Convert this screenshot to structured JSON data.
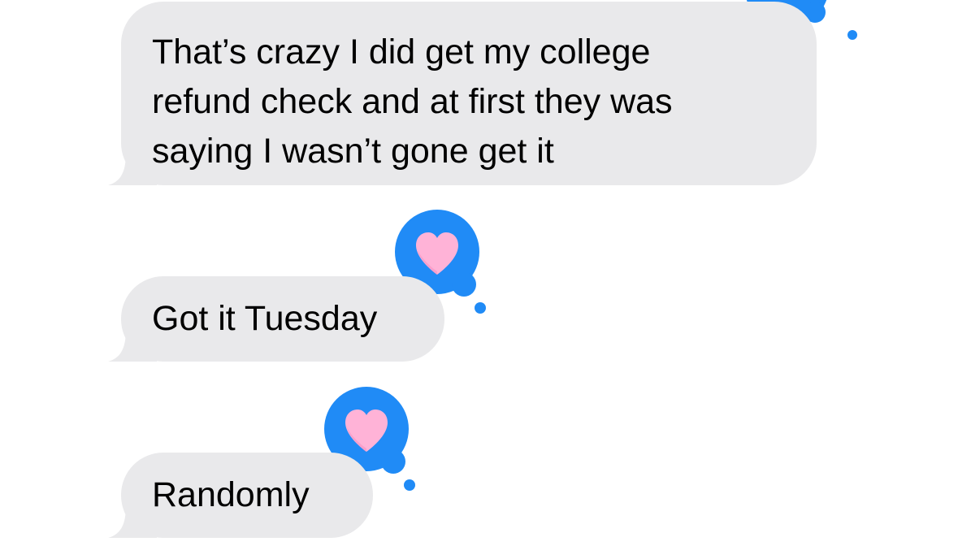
{
  "messages": [
    {
      "text": "That’s crazy I did get my college\nrefund check and at first they was\nsaying I wasn’t gone get it",
      "reaction": "heart-icon"
    },
    {
      "text": "Got it Tuesday",
      "reaction": "heart-icon"
    },
    {
      "text": "Randomly",
      "reaction": "heart-icon"
    }
  ],
  "colors": {
    "received_bubble": "#e9e9eb",
    "reaction_blue": "#208bf6",
    "heart": "#ffb3d7"
  }
}
